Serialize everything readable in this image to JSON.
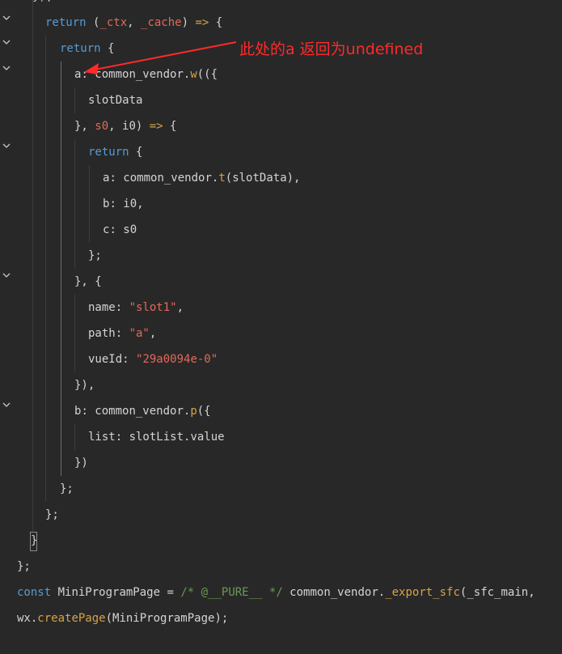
{
  "editor": {
    "annotation": "此处的a 返回为undefined",
    "lines": [
      {
        "tokens": [
          {
            "t": "});",
            "c": "punc"
          }
        ]
      },
      {
        "tokens": [
          {
            "t": "return",
            "c": "kw"
          },
          {
            "t": " (",
            "c": "punc"
          },
          {
            "t": "_ctx",
            "c": "param"
          },
          {
            "t": ", ",
            "c": "punc"
          },
          {
            "t": "_cache",
            "c": "param"
          },
          {
            "t": ") ",
            "c": "punc"
          },
          {
            "t": "=>",
            "c": "arrowop"
          },
          {
            "t": " {",
            "c": "punc"
          }
        ]
      },
      {
        "tokens": [
          {
            "t": "return",
            "c": "kw"
          },
          {
            "t": " {",
            "c": "punc"
          }
        ]
      },
      {
        "tokens": [
          {
            "t": "a",
            "c": "prop"
          },
          {
            "t": ": ",
            "c": "punc"
          },
          {
            "t": "common_vendor",
            "c": "var"
          },
          {
            "t": ".",
            "c": "punc"
          },
          {
            "t": "w",
            "c": "method"
          },
          {
            "t": "(({",
            "c": "punc"
          }
        ]
      },
      {
        "tokens": [
          {
            "t": "slotData",
            "c": "var"
          }
        ]
      },
      {
        "tokens": [
          {
            "t": "}, ",
            "c": "punc"
          },
          {
            "t": "s0",
            "c": "param"
          },
          {
            "t": ", ",
            "c": "punc"
          },
          {
            "t": "i0",
            "c": "var"
          },
          {
            "t": ") ",
            "c": "punc"
          },
          {
            "t": "=>",
            "c": "arrowop"
          },
          {
            "t": " {",
            "c": "punc"
          }
        ]
      },
      {
        "tokens": [
          {
            "t": "return",
            "c": "kw"
          },
          {
            "t": " {",
            "c": "punc"
          }
        ]
      },
      {
        "tokens": [
          {
            "t": "a",
            "c": "prop"
          },
          {
            "t": ": ",
            "c": "punc"
          },
          {
            "t": "common_vendor",
            "c": "var"
          },
          {
            "t": ".",
            "c": "punc"
          },
          {
            "t": "t",
            "c": "method"
          },
          {
            "t": "(",
            "c": "punc"
          },
          {
            "t": "slotData",
            "c": "var"
          },
          {
            "t": "),",
            "c": "punc"
          }
        ]
      },
      {
        "tokens": [
          {
            "t": "b",
            "c": "prop"
          },
          {
            "t": ": ",
            "c": "punc"
          },
          {
            "t": "i0",
            "c": "var"
          },
          {
            "t": ",",
            "c": "punc"
          }
        ]
      },
      {
        "tokens": [
          {
            "t": "c",
            "c": "prop"
          },
          {
            "t": ": ",
            "c": "punc"
          },
          {
            "t": "s0",
            "c": "var"
          }
        ]
      },
      {
        "tokens": [
          {
            "t": "};",
            "c": "punc"
          }
        ]
      },
      {
        "tokens": [
          {
            "t": "}, {",
            "c": "punc"
          }
        ]
      },
      {
        "tokens": [
          {
            "t": "name",
            "c": "prop"
          },
          {
            "t": ": ",
            "c": "punc"
          },
          {
            "t": "\"slot1\"",
            "c": "str"
          },
          {
            "t": ",",
            "c": "punc"
          }
        ]
      },
      {
        "tokens": [
          {
            "t": "path",
            "c": "prop"
          },
          {
            "t": ": ",
            "c": "punc"
          },
          {
            "t": "\"a\"",
            "c": "str"
          },
          {
            "t": ",",
            "c": "punc"
          }
        ]
      },
      {
        "tokens": [
          {
            "t": "vueId",
            "c": "prop"
          },
          {
            "t": ": ",
            "c": "punc"
          },
          {
            "t": "\"29a0094e-0\"",
            "c": "str"
          }
        ]
      },
      {
        "tokens": [
          {
            "t": "}),",
            "c": "punc"
          }
        ]
      },
      {
        "tokens": [
          {
            "t": "b",
            "c": "prop"
          },
          {
            "t": ": ",
            "c": "punc"
          },
          {
            "t": "common_vendor",
            "c": "var"
          },
          {
            "t": ".",
            "c": "punc"
          },
          {
            "t": "p",
            "c": "method"
          },
          {
            "t": "({",
            "c": "punc"
          }
        ]
      },
      {
        "tokens": [
          {
            "t": "list",
            "c": "prop"
          },
          {
            "t": ": ",
            "c": "punc"
          },
          {
            "t": "slotList",
            "c": "var"
          },
          {
            "t": ".",
            "c": "punc"
          },
          {
            "t": "value",
            "c": "var"
          }
        ]
      },
      {
        "tokens": [
          {
            "t": "})",
            "c": "punc"
          }
        ]
      },
      {
        "tokens": [
          {
            "t": "};",
            "c": "punc"
          }
        ]
      },
      {
        "tokens": [
          {
            "t": "};",
            "c": "punc"
          }
        ]
      },
      {
        "tokens": [
          {
            "t": "}",
            "c": "punc"
          }
        ]
      },
      {
        "tokens": [
          {
            "t": "};",
            "c": "punc"
          }
        ]
      },
      {
        "tokens": [
          {
            "t": "const",
            "c": "kw"
          },
          {
            "t": " MiniProgramPage = ",
            "c": "var"
          },
          {
            "t": "/* @__PURE__ */",
            "c": "cmt"
          },
          {
            "t": " common_vendor.",
            "c": "var"
          },
          {
            "t": "_export_sfc",
            "c": "method"
          },
          {
            "t": "(_sfc_main,",
            "c": "punc"
          }
        ]
      },
      {
        "tokens": [
          {
            "t": "wx",
            "c": "var"
          },
          {
            "t": ".",
            "c": "punc"
          },
          {
            "t": "createPage",
            "c": "method"
          },
          {
            "t": "(MiniProgramPage);",
            "c": "punc"
          }
        ]
      }
    ],
    "fold_icons": [
      "chevron-down-icon",
      "chevron-down-icon",
      "chevron-down-icon",
      "chevron-down-icon",
      "chevron-down-icon",
      "chevron-down-icon"
    ]
  }
}
